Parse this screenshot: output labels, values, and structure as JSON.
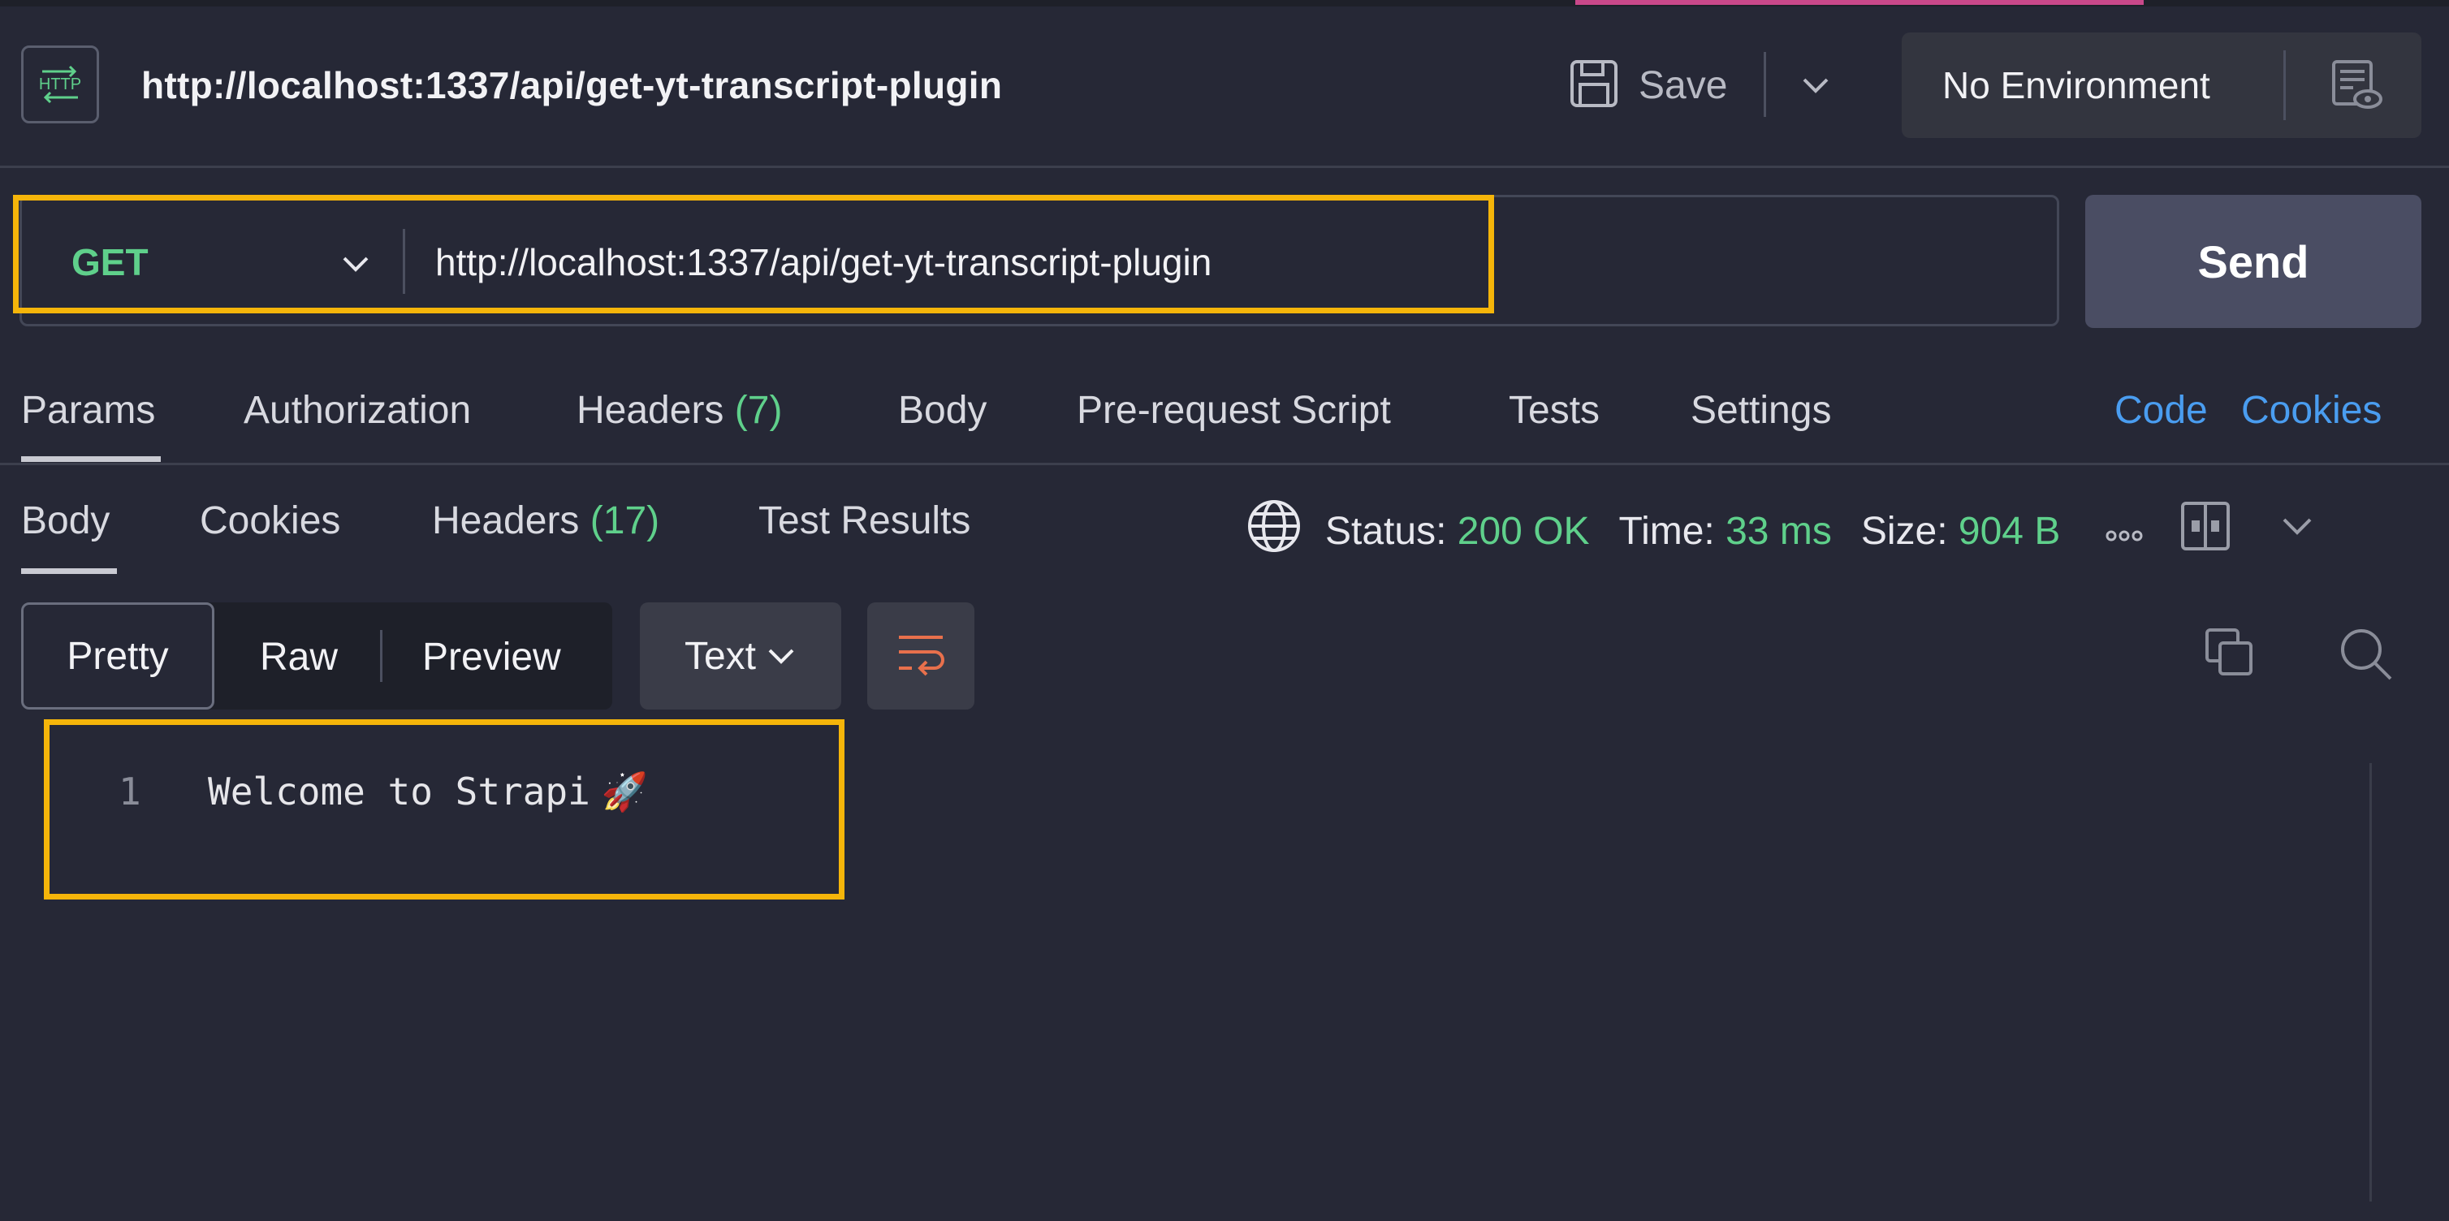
{
  "header": {
    "request_title": "http://localhost:1337/api/get-yt-transcript-plugin",
    "save_label": "Save",
    "environment_label": "No Environment",
    "icons": [
      "http-icon",
      "save-icon",
      "chevron-down-icon",
      "environment-eye-icon"
    ]
  },
  "request": {
    "method": "GET",
    "url": "http://localhost:1337/api/get-yt-transcript-plugin",
    "send_label": "Send",
    "method_color": "#5fd08b"
  },
  "request_tabs": {
    "params": "Params",
    "authorization": "Authorization",
    "headers": "Headers",
    "headers_count": "(7)",
    "body": "Body",
    "pre_request": "Pre-request Script",
    "tests": "Tests",
    "settings": "Settings",
    "code": "Code",
    "cookies": "Cookies",
    "active": "Params"
  },
  "response_tabs": {
    "body": "Body",
    "cookies": "Cookies",
    "headers": "Headers",
    "headers_count": "(17)",
    "test_results": "Test Results",
    "active": "Body"
  },
  "status": {
    "status_label": "Status:",
    "status_value": "200 OK",
    "time_label": "Time:",
    "time_value": "33 ms",
    "size_label": "Size:",
    "size_value": "904 B",
    "accent": "#5fd08b"
  },
  "format_toolbar": {
    "pretty": "Pretty",
    "raw": "Raw",
    "preview": "Preview",
    "text_type": "Text",
    "active": "Pretty",
    "wrap_icon_color": "#e8704c"
  },
  "response_body": {
    "lines": [
      {
        "number": "1",
        "text": "Welcome to Strapi",
        "emoji": "🚀"
      }
    ]
  },
  "colors": {
    "background": "#262836",
    "highlight": "#f5b50a",
    "link": "#4a9df0",
    "send_button": "#4a4d63"
  }
}
